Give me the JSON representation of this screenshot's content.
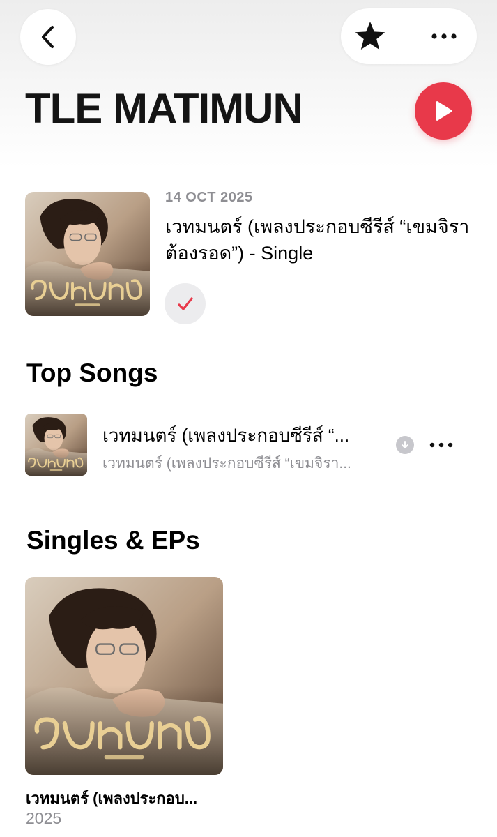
{
  "header": {
    "back_icon": "chevron-left-icon",
    "favorite_icon": "star-filled-icon",
    "more_icon": "ellipsis-icon"
  },
  "artist": {
    "name": "TLE MATIMUN",
    "play_icon": "play-icon",
    "accent_color": "#e8394a"
  },
  "latest_release": {
    "date": "14 OCT 2025",
    "title": "เวทมนตร์ (เพลงประกอบซีรีส์ “เขมจิราต้องรอด”) - Single",
    "status_icon": "checkmark-icon",
    "cover_lettering": "เวทมนตร์"
  },
  "top_songs": {
    "heading": "Top Songs",
    "items": [
      {
        "title": "เวทมนตร์ (เพลงประกอบซีรีส์ “...",
        "subtitle": "เวทมนตร์ (เพลงประกอบซีรีส์ “เขมจิรา...",
        "download_icon": "download-circle-icon",
        "more_icon": "ellipsis-icon"
      }
    ]
  },
  "singles_eps": {
    "heading": "Singles & EPs",
    "items": [
      {
        "title": "เวทมนตร์ (เพลงประกอบ...",
        "year": "2025"
      }
    ]
  }
}
